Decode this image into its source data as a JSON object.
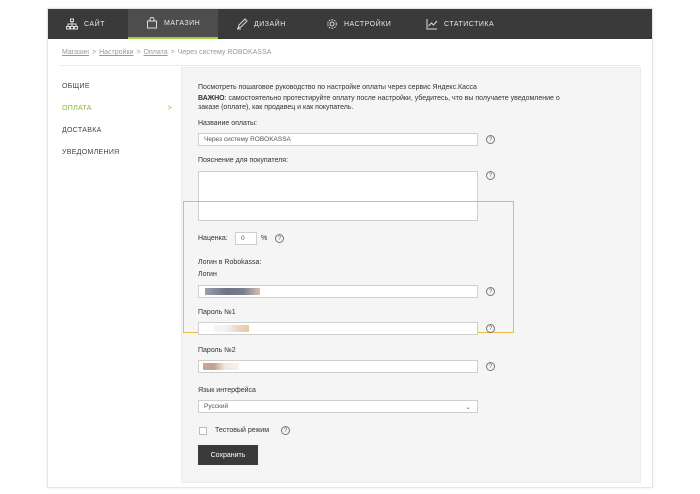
{
  "topnav": [
    {
      "label": "САЙТ",
      "icon": "sitemap-icon",
      "active": false
    },
    {
      "label": "МАГАЗИН",
      "icon": "bag-icon",
      "active": true
    },
    {
      "label": "ДИЗАЙН",
      "icon": "pencil-icon",
      "active": false
    },
    {
      "label": "НАСТРОЙКИ",
      "icon": "gear-icon",
      "active": false
    },
    {
      "label": "СТАТИСТИКА",
      "icon": "chart-icon",
      "active": false
    }
  ],
  "breadcrumb": {
    "items": [
      "Магазин",
      "Настройки",
      "Оплата"
    ],
    "separator": ">",
    "current": "Через систему ROBOKASSA"
  },
  "sidebar": {
    "items": [
      {
        "label": "ОБЩИЕ",
        "active": false
      },
      {
        "label": "ОПЛАТА",
        "active": true,
        "arrow": ">"
      },
      {
        "label": "ДОСТАВКА",
        "active": false
      },
      {
        "label": "УВЕДОМЛЕНИЯ",
        "active": false
      }
    ]
  },
  "form": {
    "guide_text": "Посмотреть пошаговое руководство по настройке оплаты через сервис Яндекс.Касса",
    "warning_label": "ВАЖНО",
    "warning_line1": ": самостоятельно протестируйте оплату после настройки, убедитесь, что вы получаете уведомление о",
    "warning_line2": "заказе (оплате), как продавец и как покупатель.",
    "name_label": "Название оплаты:",
    "name_value": "Через систему ROBOKASSA",
    "desc_label": "Пояснение для покупателя:",
    "desc_value": "",
    "markup_label": "Наценка:",
    "markup_value": "0",
    "markup_unit": "%",
    "robokassa_title": "Логин в Robokassa:",
    "login_label": "Логин",
    "pass1_label": "Пароль №1",
    "pass2_label": "Пароль №2",
    "lang_label": "Язык интерфейса",
    "lang_value": "Русский",
    "test_mode_label": "Тестовый режим",
    "help_glyph": "?",
    "chevron": "⌄",
    "save_label": "Сохранить"
  },
  "colors": {
    "accent": "#9bd13a",
    "highlight": "#f0b74a",
    "nav_bg": "#3a3a3a"
  }
}
